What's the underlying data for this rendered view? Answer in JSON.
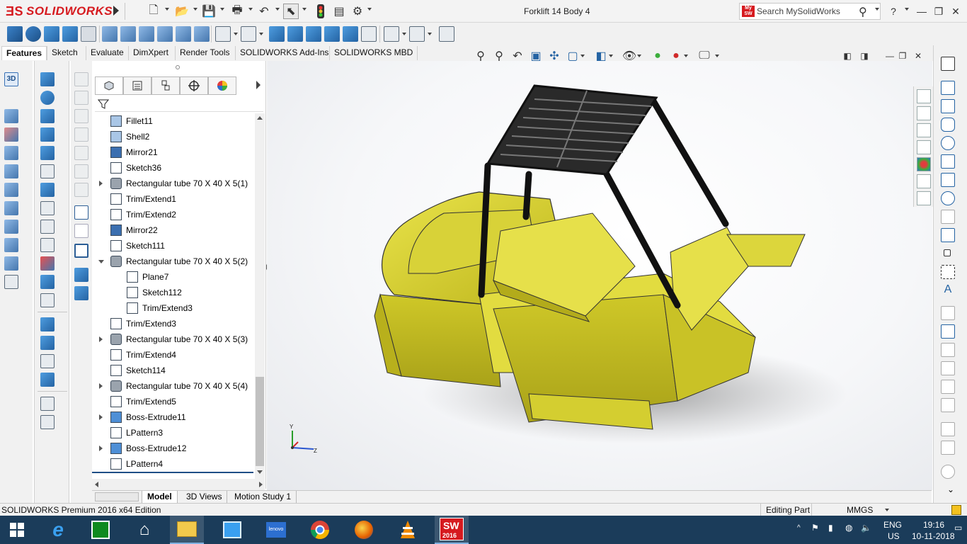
{
  "app": {
    "brand": "SOLIDWORKS",
    "document_title": "Forklift 14 Body 4",
    "search": {
      "placeholder": "Search MySolidWorks",
      "badge": "My SW"
    },
    "help": "?"
  },
  "command_tabs": [
    {
      "label": "Features",
      "active": true
    },
    {
      "label": "Sketch"
    },
    {
      "label": "Evaluate"
    },
    {
      "label": "DimXpert"
    },
    {
      "label": "Render Tools"
    },
    {
      "label": "SOLIDWORKS Add-Ins"
    },
    {
      "label": "SOLIDWORKS MBD"
    }
  ],
  "feature_tree": [
    {
      "label": "Fillet11",
      "icon": "fillet-icon",
      "expandable": false,
      "indent": 0
    },
    {
      "label": "Shell2",
      "icon": "shell-icon",
      "expandable": false,
      "indent": 0
    },
    {
      "label": "Mirror21",
      "icon": "mirror-icon",
      "expandable": false,
      "indent": 0
    },
    {
      "label": "Sketch36",
      "icon": "sketch-icon",
      "expandable": false,
      "indent": 0
    },
    {
      "label": "Rectangular tube 70 X 40 X 5(1)",
      "icon": "structural-member-icon",
      "expandable": true,
      "indent": 0
    },
    {
      "label": "Trim/Extend1",
      "icon": "trim-extend-icon",
      "expandable": false,
      "indent": 0
    },
    {
      "label": "Trim/Extend2",
      "icon": "trim-extend-icon",
      "expandable": false,
      "indent": 0
    },
    {
      "label": "Mirror22",
      "icon": "mirror-icon",
      "expandable": false,
      "indent": 0
    },
    {
      "label": "Sketch111",
      "icon": "sketch-icon",
      "expandable": false,
      "indent": 0
    },
    {
      "label": "Rectangular tube 70 X 40 X 5(2)",
      "icon": "structural-member-icon",
      "expandable": true,
      "open": true,
      "indent": 0
    },
    {
      "label": "Plane7",
      "icon": "plane-icon",
      "expandable": false,
      "indent": 1
    },
    {
      "label": "Sketch112",
      "icon": "sketch-icon",
      "expandable": false,
      "indent": 1
    },
    {
      "label": "Trim/Extend3",
      "icon": "body-icon",
      "expandable": false,
      "indent": 1
    },
    {
      "label": "Trim/Extend3",
      "icon": "trim-extend-icon",
      "expandable": false,
      "indent": 0
    },
    {
      "label": "Rectangular tube 70 X 40 X 5(3)",
      "icon": "structural-member-icon",
      "expandable": true,
      "indent": 0
    },
    {
      "label": "Trim/Extend4",
      "icon": "trim-extend-icon",
      "expandable": false,
      "indent": 0
    },
    {
      "label": "Sketch114",
      "icon": "sketch-icon",
      "expandable": false,
      "indent": 0
    },
    {
      "label": "Rectangular tube 70 X 40 X 5(4)",
      "icon": "structural-member-icon",
      "expandable": true,
      "indent": 0
    },
    {
      "label": "Trim/Extend5",
      "icon": "trim-extend-icon",
      "expandable": false,
      "indent": 0
    },
    {
      "label": "Boss-Extrude11",
      "icon": "extrude-icon",
      "expandable": true,
      "indent": 0
    },
    {
      "label": "LPattern3",
      "icon": "linear-pattern-icon",
      "expandable": false,
      "indent": 0
    },
    {
      "label": "Boss-Extrude12",
      "icon": "extrude-icon",
      "expandable": true,
      "indent": 0
    },
    {
      "label": "LPattern4",
      "icon": "linear-pattern-icon",
      "expandable": false,
      "indent": 0
    }
  ],
  "bottom_tabs": [
    {
      "label": "Model",
      "active": true
    },
    {
      "label": "3D Views"
    },
    {
      "label": "Motion Study 1"
    }
  ],
  "status": {
    "edition": "SOLIDWORKS Premium 2016 x64 Edition",
    "mode": "Editing Part",
    "units": "MMGS"
  },
  "triad": {
    "y": "Y",
    "z": "Z"
  },
  "taskbar": {
    "lang1": "ENG",
    "lang2": "US",
    "time": "19:16",
    "date": "10-11-2018",
    "sw_badge": "2016",
    "sw_label": "SW",
    "apps": [
      "start-icon",
      "ie-icon",
      "store-icon",
      "home-icon",
      "explorer-icon",
      "mail-icon",
      "lenovo-icon",
      "chrome-icon",
      "firefox-icon",
      "vlc-icon",
      "solidworks-icon"
    ]
  },
  "colors": {
    "accent": "#d61a1f",
    "model_yellow": "#d9d433",
    "frame_black": "#1e1e1e",
    "taskbar": "#1b3c5a"
  }
}
